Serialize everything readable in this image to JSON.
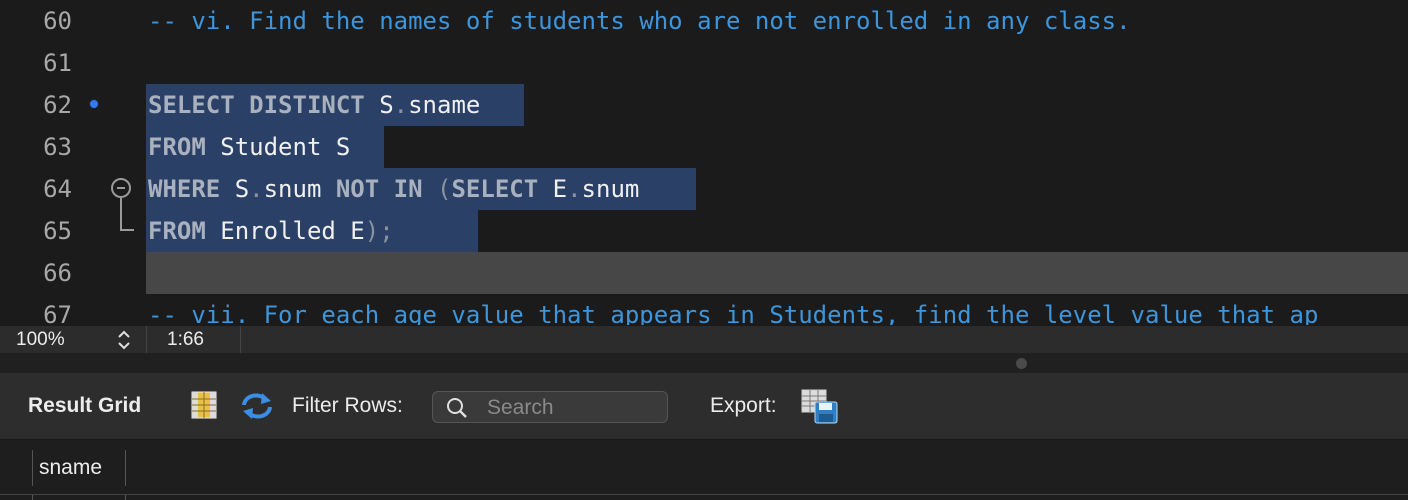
{
  "editor": {
    "lines": [
      {
        "num": "60",
        "text": "-- vi. Find the names of students who are not enrolled in any class."
      },
      {
        "num": "61",
        "text": ""
      },
      {
        "num": "62",
        "tokens": [
          "SELECT",
          "DISTINCT",
          "S",
          ".",
          "sname"
        ]
      },
      {
        "num": "63",
        "tokens": [
          "FROM",
          "Student S"
        ]
      },
      {
        "num": "64",
        "tokens": [
          "WHERE",
          "S",
          ".",
          "snum",
          "NOT",
          "IN",
          "(",
          "SELECT",
          "E",
          ".",
          "snum"
        ]
      },
      {
        "num": "65",
        "tokens": [
          "FROM",
          "Enrolled E",
          ");"
        ]
      },
      {
        "num": "66",
        "text": ""
      },
      {
        "num": "67",
        "text": "-- vii. For each age value that appears in Students, find the level value that ap"
      }
    ],
    "colors": {
      "comment": "#3d95dc",
      "keyword": "#a9b1bf",
      "selection": "#2a4067",
      "current_line": "#474747",
      "breakpoint": "#3478f6"
    }
  },
  "status": {
    "zoom": "100%",
    "cursor": "1:66"
  },
  "result_toolbar": {
    "title": "Result Grid",
    "filter_label": "Filter Rows:",
    "search_placeholder": "Search",
    "export_label": "Export:",
    "grid_icon": "grid-toggle-icon",
    "refresh_icon": "refresh-icon",
    "export_icon": "export-icon"
  },
  "grid": {
    "columns": [
      "sname"
    ]
  }
}
